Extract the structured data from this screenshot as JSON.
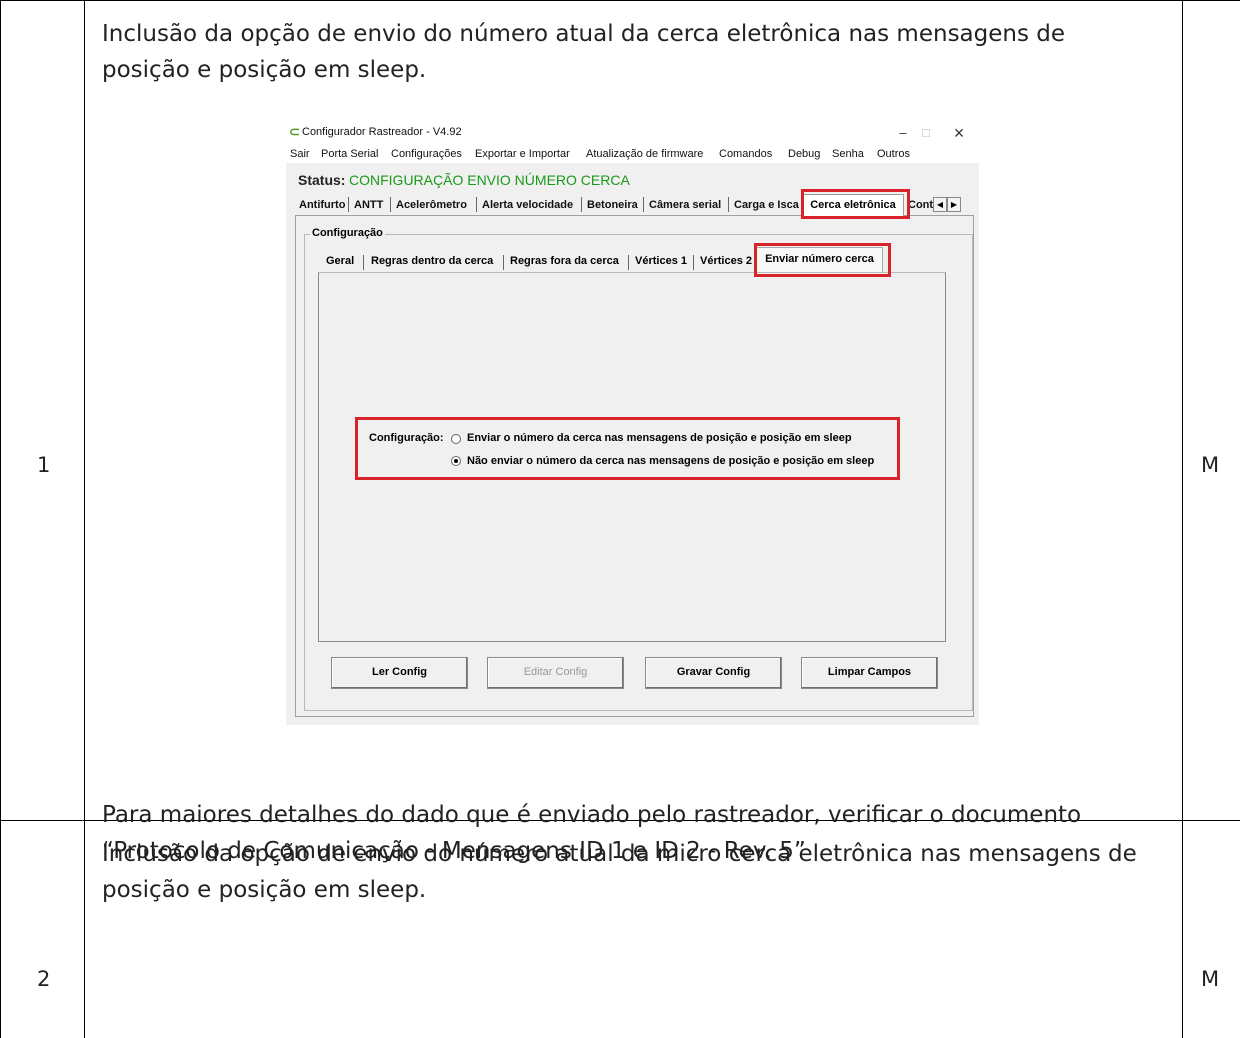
{
  "table": {
    "rows": [
      {
        "number": "1",
        "description": "Inclusão da opção de envio do número atual da cerca eletrônica nas mensagens de posição e posição em sleep.",
        "description_line1": "Inclusão da opção de envio do número atual da cerca eletrônica nas mensagens de",
        "description_line2": "posição e posição em sleep.",
        "note_line1": "Para maiores detalhes do dado que é enviado pelo rastreador, verificar o documento",
        "note_line2": "“Protocolo de Comunicação - Mensagens ID 1 e ID 2 - Rev. 5”",
        "type": "M"
      },
      {
        "number": "2",
        "description_line1": "Inclusão da opção de envio do número atual da micro cerca eletrônica nas mensagens de",
        "description_line2": "posição e posição em sleep.",
        "type": "M"
      }
    ]
  },
  "app": {
    "window_title": "Configurador Rastreador - V4.92",
    "window_controls": {
      "minimize": "–",
      "maximize": "□",
      "close": "×"
    },
    "menu": [
      "Sair",
      "Porta Serial",
      "Configurações",
      "Exportar e Importar",
      "Atualização de firmware",
      "Comandos",
      "Debug",
      "Senha",
      "Outros"
    ],
    "status_label": "Status:",
    "status_value": "CONFIGURAÇÃO ENVIO NÚMERO CERCA",
    "status_color": "#1a9a1a",
    "main_tabs": [
      "Antifurto",
      "ANTT",
      "Acelerômetro",
      "Alerta velocidade",
      "Betoneira",
      "Câmera serial",
      "Carga e Isca",
      "Cerca eletrônica",
      "Cont"
    ],
    "main_tab_active": "Cerca eletrônica",
    "tab_scroll": {
      "left": "◀",
      "right": "▶"
    },
    "group_title": "Configuração",
    "sub_tabs": [
      "Geral",
      "Regras dentro da cerca",
      "Regras fora da cerca",
      "Vértices 1",
      "Vértices 2",
      "Enviar número cerca"
    ],
    "sub_tab_active": "Enviar número cerca",
    "config_label": "Configuração:",
    "options": [
      {
        "label": "Enviar o número da cerca nas mensagens de posição e posição em sleep",
        "selected": false
      },
      {
        "label": "Não enviar o número da cerca nas mensagens de posição e posição em sleep",
        "selected": true
      }
    ],
    "buttons": [
      {
        "label": "Ler Config",
        "enabled": true
      },
      {
        "label": "Editar Config",
        "enabled": false
      },
      {
        "label": "Gravar Config",
        "enabled": true
      },
      {
        "label": "Limpar Campos",
        "enabled": true
      }
    ],
    "highlight_color": "#d8232a"
  }
}
